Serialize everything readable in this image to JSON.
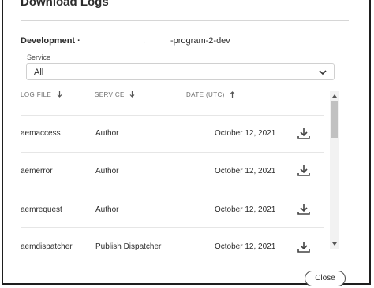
{
  "dialog": {
    "title": "Download Logs",
    "environment_name": "Development ·",
    "environment_separator": ".",
    "program_name": "-program-2-dev"
  },
  "service_filter": {
    "label": "Service",
    "selected": "All"
  },
  "table": {
    "headers": {
      "log_file": "LOG FILE",
      "service": "SERVICE",
      "date": "DATE (UTC)"
    },
    "sort_icons": {
      "log_file": "arrow-down-icon",
      "service": "arrow-down-icon",
      "date": "arrow-up-icon"
    },
    "rows": [
      {
        "log_file": "aemaccess",
        "service": "Author",
        "date": "October 12, 2021"
      },
      {
        "log_file": "aemerror",
        "service": "Author",
        "date": "October 12, 2021"
      },
      {
        "log_file": "aemrequest",
        "service": "Author",
        "date": "October 12, 2021"
      },
      {
        "log_file": "aemdispatcher",
        "service": "Publish Dispatcher",
        "date": "October 12, 2021"
      }
    ]
  },
  "footer": {
    "close_label": "Close"
  }
}
